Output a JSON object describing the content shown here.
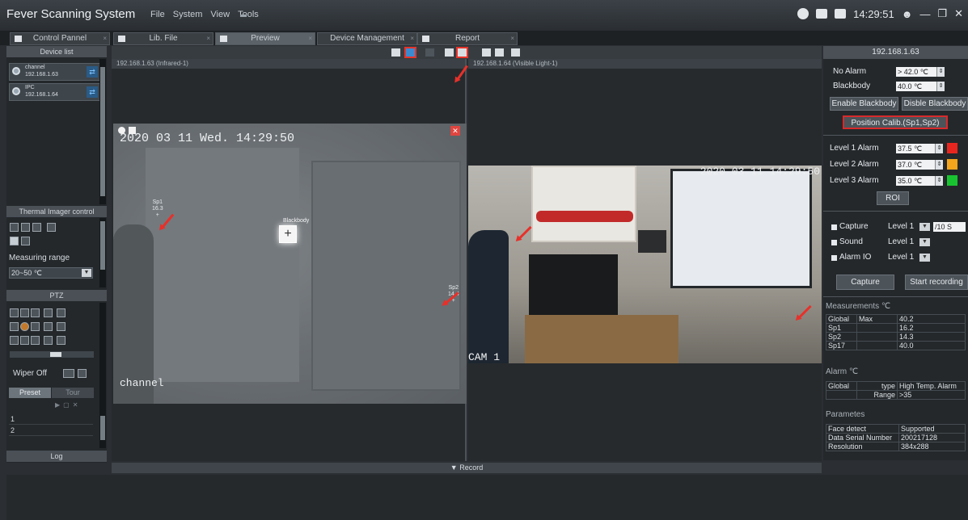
{
  "app": {
    "title": "Fever Scanning System"
  },
  "menu": [
    "File",
    "System",
    "View",
    "Tools"
  ],
  "tray": {
    "clock": "14:29:51"
  },
  "tabs": [
    {
      "label": "Control Pannel",
      "active": false
    },
    {
      "label": "Lib. File",
      "active": false
    },
    {
      "label": "Preview",
      "active": true
    },
    {
      "label": "Device Management",
      "active": false
    },
    {
      "label": "Report",
      "active": false
    }
  ],
  "left": {
    "device_list_title": "Device list",
    "devices": [
      {
        "name": "channel",
        "ip": "192.168.1.63"
      },
      {
        "name": "IPC",
        "ip": "192.168.1.64"
      }
    ],
    "thermal_title": "Thermal Imager control",
    "measuring_range_label": "Measuring range",
    "measuring_range_value": "20~50 ℃",
    "ptz_title": "PTZ",
    "wiper_label": "Wiper Off",
    "preset_tab": "Preset",
    "tour_tab": "Tour",
    "preset_rows": [
      "1",
      "2"
    ],
    "log_title": "Log"
  },
  "panes": {
    "left_caption": "192.168.1.63 (Infrared-1)",
    "right_caption": "192.168.1.64 (Visible Light-1)",
    "ir_osd": "2020 03 11 Wed. 14:29:50",
    "ir_channel": "channel",
    "spots": [
      {
        "name": "Sp1",
        "value": "16.3"
      },
      {
        "name": "Sp2",
        "value": "14.4"
      }
    ],
    "blackbody_label": "Blackbody",
    "vis_osd": "2020 03 11 14:29:50",
    "vis_cam": "CAM 1"
  },
  "right": {
    "device_ip": "192.168.1.63",
    "no_alarm_label": "No Alarm",
    "no_alarm_value": "> 42.0 ℃",
    "blackbody_label": "Blackbody",
    "blackbody_value": "40.0 ℃",
    "enable_blackbody": "Enable Blackbody",
    "disable_blackbody": "Disble Blackbody",
    "position_calib": "Position Calib.(Sp1,Sp2)",
    "levels": [
      {
        "label": "Level 1 Alarm",
        "value": "37.5 ℃",
        "color": "#e8261f"
      },
      {
        "label": "Level 2 Alarm",
        "value": "37.0 ℃",
        "color": "#f4a51c"
      },
      {
        "label": "Level 3 Alarm",
        "value": "35.0 ℃",
        "color": "#19c431"
      }
    ],
    "roi": "ROI",
    "capture_opt": {
      "label": "Capture",
      "level": "Level 1",
      "interval": "/10 S"
    },
    "sound_opt": {
      "label": "Sound",
      "level": "Level 1"
    },
    "alarm_io_opt": {
      "label": "Alarm IO",
      "level": "Level 1"
    },
    "capture_btn": "Capture",
    "record_btn": "Start recording",
    "measurements_title": "Measurements ℃",
    "measurements": [
      [
        "Global",
        "Max",
        "40.2"
      ],
      [
        "Sp1",
        "",
        "16.2"
      ],
      [
        "Sp2",
        "",
        "14.3"
      ],
      [
        "Sp17",
        "",
        "40.0"
      ]
    ],
    "alarm_title": "Alarm ℃",
    "alarm_rows": [
      [
        "Global",
        "type",
        "High Temp. Alarm"
      ],
      [
        "",
        "Range",
        ">35"
      ]
    ],
    "params_title": "Parametes",
    "params": [
      [
        "Face detect",
        "Supported"
      ],
      [
        "Data Serial Number",
        "200217128"
      ],
      [
        "Resolution",
        "384x288"
      ]
    ]
  },
  "bottom": {
    "record_label": "Record"
  }
}
